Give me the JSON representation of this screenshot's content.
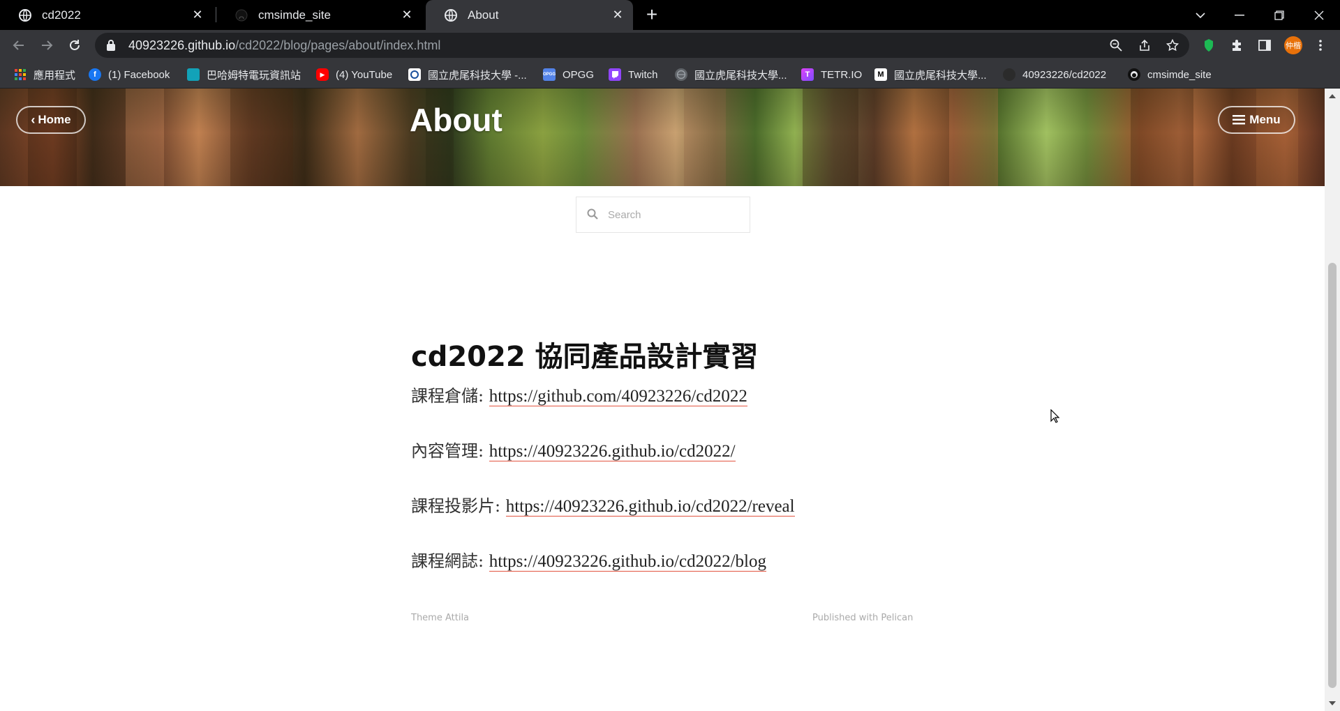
{
  "tabs": [
    {
      "title": "cd2022",
      "favicon": "globe-icon",
      "active": false
    },
    {
      "title": "cmsimde_site",
      "favicon": "github-icon",
      "active": false
    },
    {
      "title": "About",
      "favicon": "globe-icon",
      "active": true
    }
  ],
  "address_bar": {
    "host": "40923226.github.io",
    "path": "/cd2022/blog/pages/about/index.html"
  },
  "profile": {
    "label": "仲楷"
  },
  "bookmarks": [
    {
      "label": "應用程式",
      "icon": "apps-grid-icon"
    },
    {
      "label": "(1) Facebook",
      "icon": "facebook-icon"
    },
    {
      "label": "巴哈姆特電玩資訊站",
      "icon": "bahamut-icon"
    },
    {
      "label": "(4) YouTube",
      "icon": "youtube-icon"
    },
    {
      "label": "國立虎尾科技大學 -...",
      "icon": "nfu-icon"
    },
    {
      "label": "OPGG",
      "icon": "opgg-icon"
    },
    {
      "label": "Twitch",
      "icon": "twitch-icon"
    },
    {
      "label": "國立虎尾科技大學...",
      "icon": "globe-icon"
    },
    {
      "label": "TETR.IO",
      "icon": "tetrio-icon"
    },
    {
      "label": "國立虎尾科技大學...",
      "icon": "nfu-logo-icon"
    },
    {
      "label": "40923226/cd2022",
      "icon": "github-icon"
    },
    {
      "label": "cmsimde_site",
      "icon": "github-icon"
    }
  ],
  "page": {
    "home_label": "Home",
    "menu_label": "Menu",
    "title": "About",
    "search_placeholder": "Search",
    "post_title": "cd2022 協同產品設計實習",
    "lines": [
      {
        "label": "課程倉儲:",
        "url": "https://github.com/40923226/cd2022"
      },
      {
        "label": "內容管理:",
        "url": "https://40923226.github.io/cd2022/"
      },
      {
        "label": "課程投影片:",
        "url": "https://40923226.github.io/cd2022/reveal"
      },
      {
        "label": "課程網誌:",
        "url": "https://40923226.github.io/cd2022/blog"
      }
    ],
    "footer_left": "Theme Attila",
    "footer_right": "Published with Pelican"
  },
  "colors": {
    "tabstrip": "#000000",
    "toolbar": "#35363a",
    "omnibox": "#202124",
    "link_underline": "#e25440",
    "profile": "#e8710a"
  }
}
